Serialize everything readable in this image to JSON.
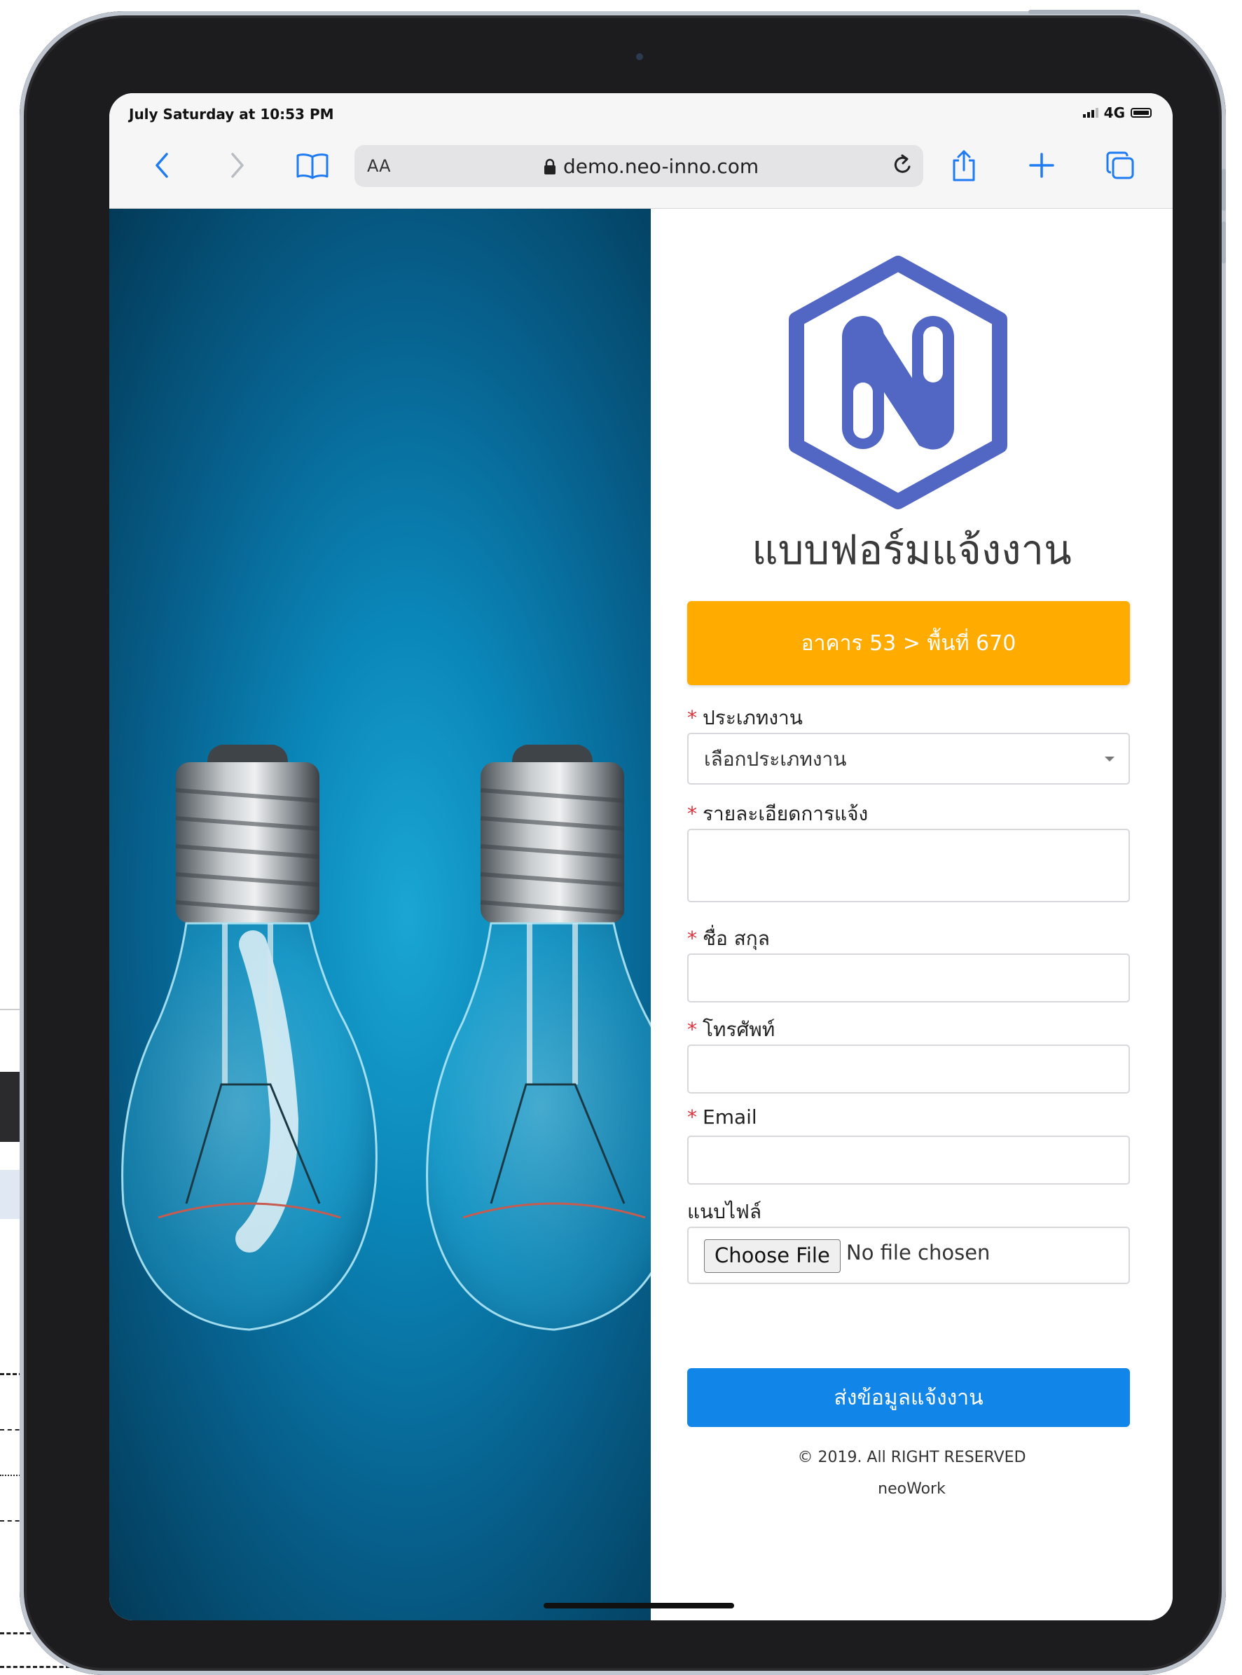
{
  "status_bar": {
    "time": "July Saturday at 10:53 PM",
    "network": "4G"
  },
  "browser": {
    "reader_label": "AA",
    "url": "demo.neo-inno.com",
    "icons": [
      "chevron-left-icon",
      "chevron-right-icon",
      "book-icon",
      "lock-icon",
      "reload-icon",
      "share-icon",
      "plus-icon",
      "tabs-icon"
    ]
  },
  "form": {
    "title": "แบบฟอร์มแจ้งงาน",
    "location_button": "อาคาร 53 > พื้นที่ 670",
    "fields": {
      "job_type": {
        "label": "ประเภทงาน",
        "required_mark": "*",
        "value": "เลือกประเภทงาน"
      },
      "details": {
        "label": "รายละเอียดการแจ้ง",
        "required_mark": "*"
      },
      "name": {
        "label": "ชื่อ สกุล",
        "required_mark": "*"
      },
      "phone": {
        "label": "โทรศัพท์",
        "required_mark": "*"
      },
      "email": {
        "label": "Email",
        "required_mark": "*"
      },
      "attachment": {
        "label": "แนบไฟล์",
        "button": "Choose File",
        "status": "No file chosen"
      }
    },
    "submit": "ส่งข้อมูลแจ้งงาน",
    "footer_copyright": "© 2019. All RIGHT RESERVED",
    "footer_brand": "neoWork"
  },
  "colors": {
    "accent_orange": "#ffab00",
    "submit_blue": "#1185e8",
    "logo_blue": "#5266c4",
    "hero_blue": "#0a86b8"
  }
}
